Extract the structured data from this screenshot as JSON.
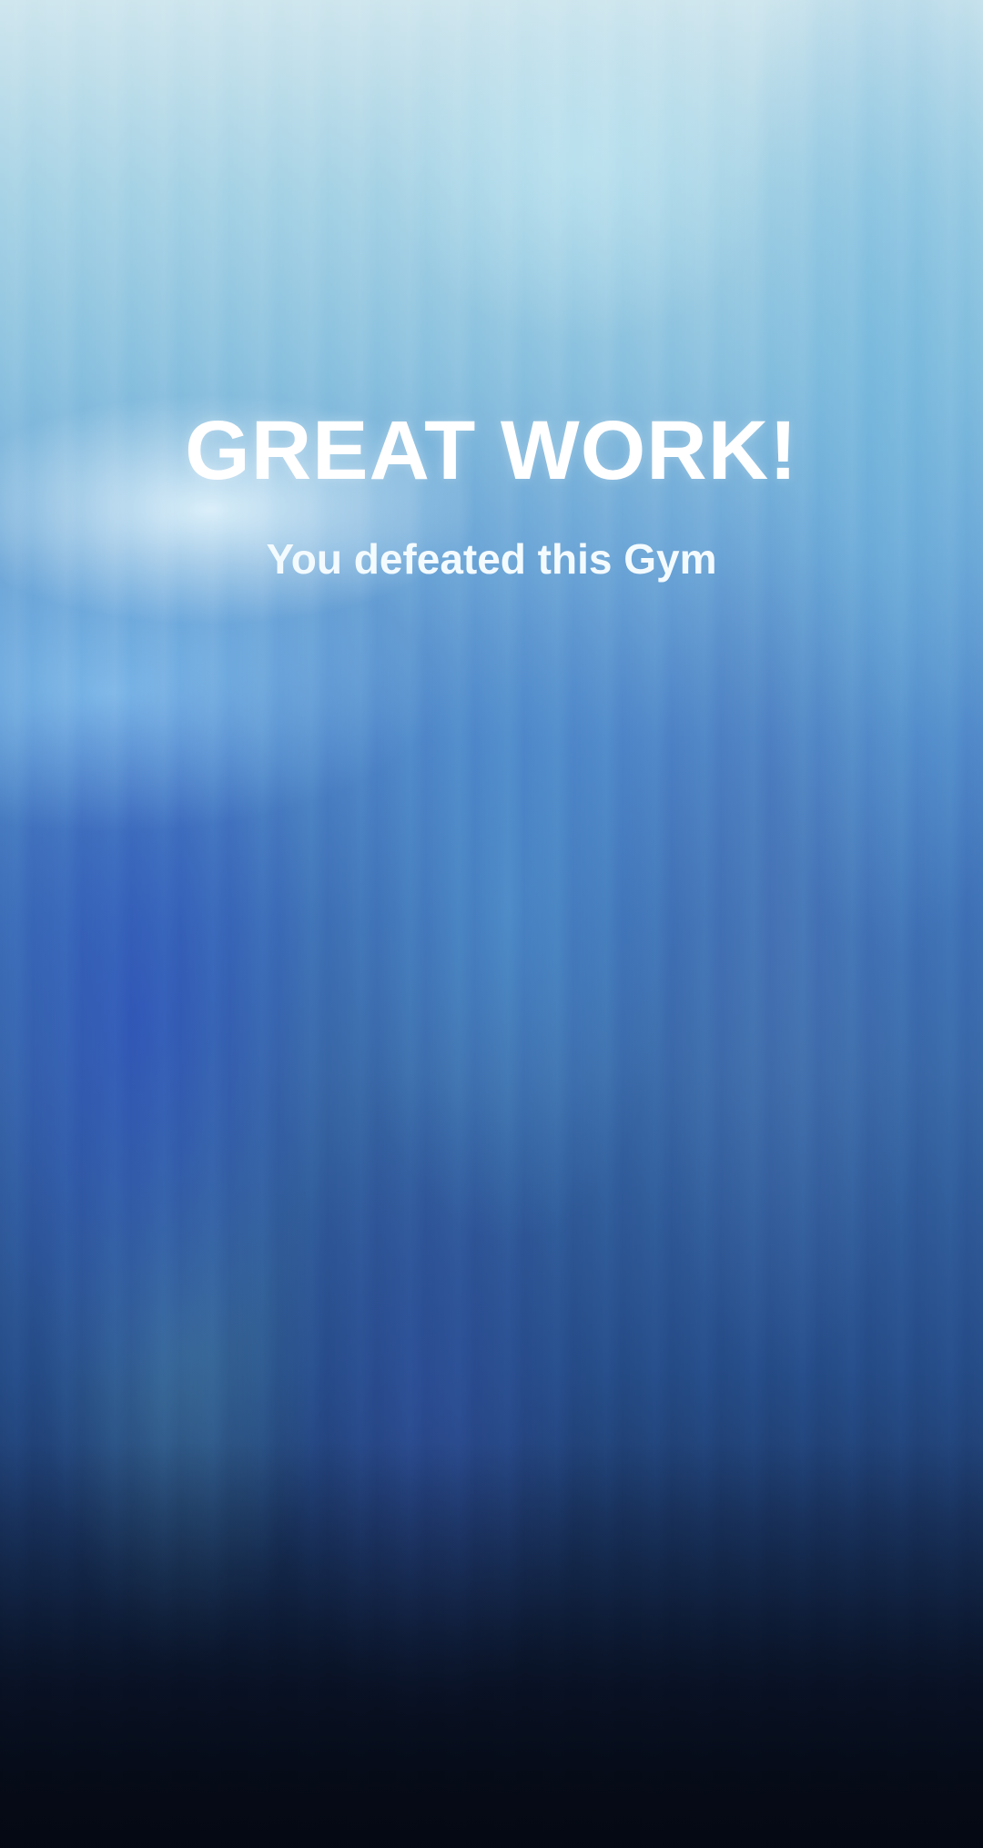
{
  "result_screen": {
    "title": "GREAT WORK!",
    "subtitle": "You defeated this Gym"
  },
  "colors": {
    "text": "#ffffff",
    "background_top": "#cfe6ee",
    "background_mid": "#3f72b6",
    "background_bottom": "#070e1c"
  }
}
